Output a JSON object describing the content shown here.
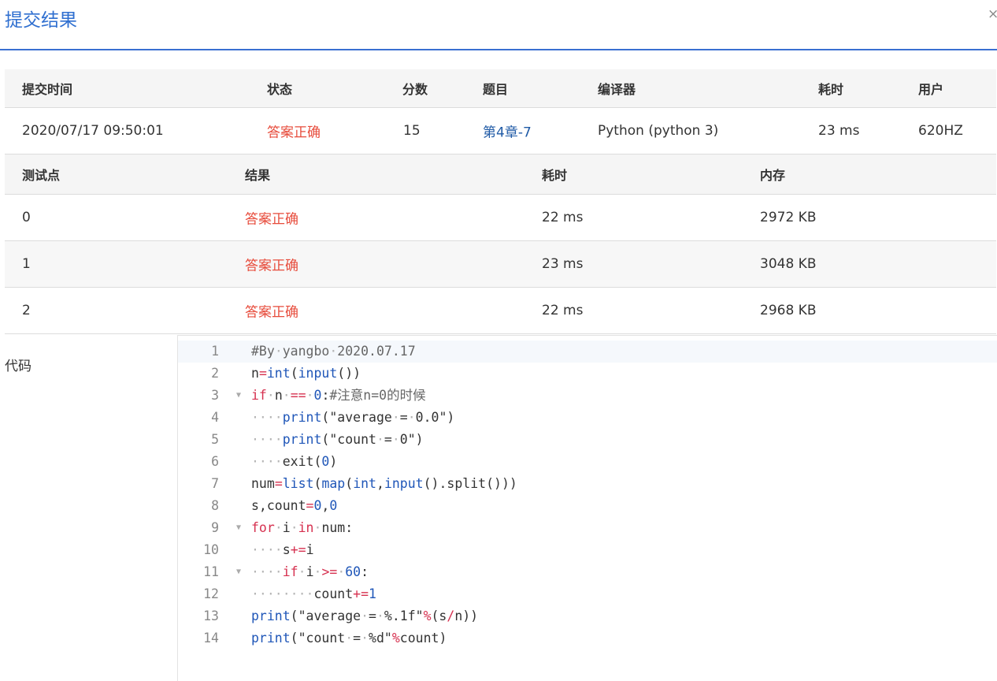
{
  "dialog": {
    "title": "提交结果",
    "close_label": "×"
  },
  "submission": {
    "headers": [
      "提交时间",
      "状态",
      "分数",
      "题目",
      "编译器",
      "耗时",
      "用户"
    ],
    "time": "2020/07/17 09:50:01",
    "status": "答案正确",
    "score": "15",
    "problem": "第4章-7",
    "compiler": "Python (python 3)",
    "elapsed": "23 ms",
    "user": "620HZ"
  },
  "tests": {
    "headers": [
      "测试点",
      "结果",
      "耗时",
      "内存"
    ],
    "rows": [
      {
        "id": "0",
        "result": "答案正确",
        "time": "22 ms",
        "memory": "2972 KB"
      },
      {
        "id": "1",
        "result": "答案正确",
        "time": "23 ms",
        "memory": "3048 KB"
      },
      {
        "id": "2",
        "result": "答案正确",
        "time": "22 ms",
        "memory": "2968 KB"
      }
    ]
  },
  "code": {
    "label": "代码",
    "line_numbers": [
      "1",
      "2",
      "3",
      "4",
      "5",
      "6",
      "7",
      "8",
      "9",
      "10",
      "11",
      "12",
      "13",
      "14"
    ],
    "fold_marker": "▼",
    "whitespace_marker": "·",
    "lines": [
      "#By yangbo 2020.07.17",
      "n=int(input())",
      "if n == 0:#注意n=0的时候",
      "    print(\"average = 0.0\")",
      "    print(\"count = 0\")",
      "    exit(0)",
      "num=list(map(int,input().split()))",
      "s,count=0,0",
      "for i in num:",
      "    s+=i",
      "    if i >= 60:",
      "        count+=1",
      "print(\"average = %.1f\"%(s/n))",
      "print(\"count = %d\"%count)"
    ]
  },
  "colors": {
    "accent": "#3a6fd2",
    "status_ok": "#e74c3c",
    "link": "#1f5aa6",
    "keyword": "#d6304f",
    "builtin": "#1f56b8"
  }
}
